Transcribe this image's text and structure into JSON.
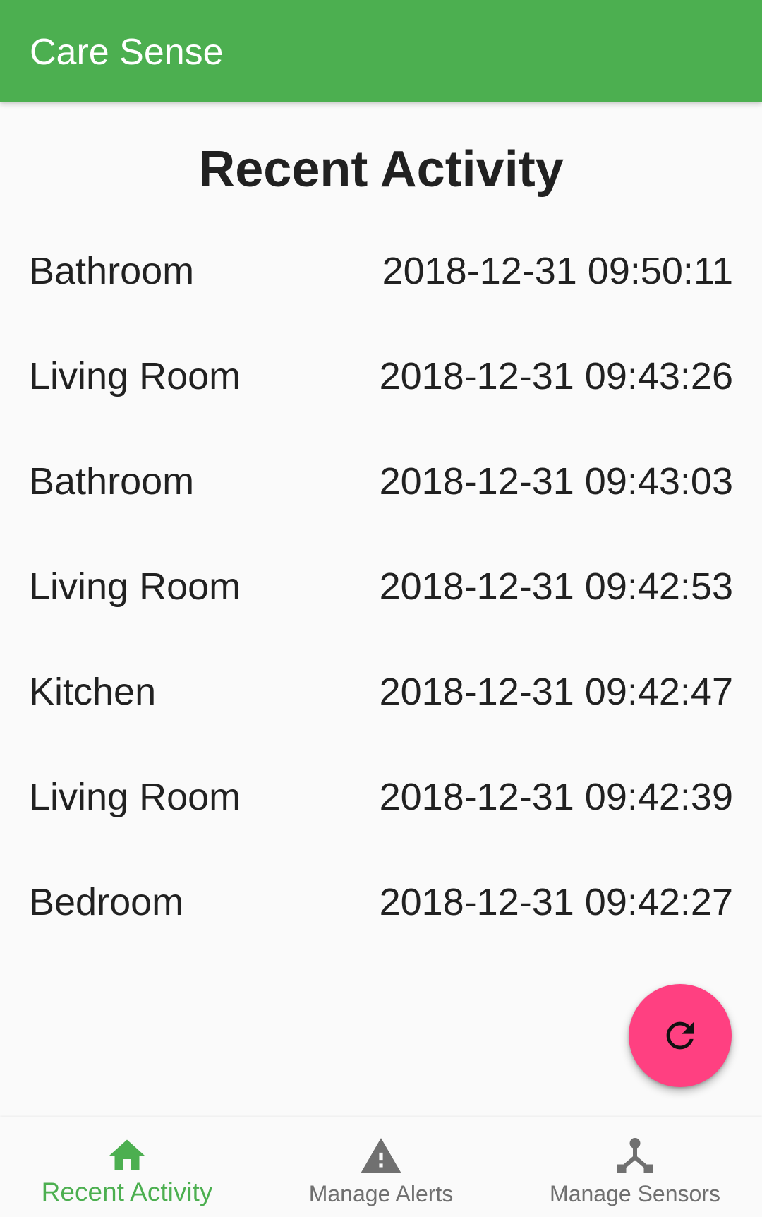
{
  "app_title": "Care Sense",
  "page_title": "Recent Activity",
  "activity": [
    {
      "room": "Bathroom",
      "time": "2018-12-31 09:50:11"
    },
    {
      "room": "Living Room",
      "time": "2018-12-31 09:43:26"
    },
    {
      "room": "Bathroom",
      "time": "2018-12-31 09:43:03"
    },
    {
      "room": "Living Room",
      "time": "2018-12-31 09:42:53"
    },
    {
      "room": "Kitchen",
      "time": "2018-12-31 09:42:47"
    },
    {
      "room": "Living Room",
      "time": "2018-12-31 09:42:39"
    },
    {
      "room": "Bedroom",
      "time": "2018-12-31 09:42:27"
    }
  ],
  "fab": {
    "icon": "refresh-icon",
    "color": "#ff4081"
  },
  "bottom_nav": [
    {
      "label": "Recent Activity",
      "icon": "home-icon",
      "active": true
    },
    {
      "label": "Manage Alerts",
      "icon": "warning-icon",
      "active": false
    },
    {
      "label": "Manage Sensors",
      "icon": "sensors-icon",
      "active": false
    }
  ],
  "colors": {
    "primary": "#4caf50",
    "accent": "#ff4081",
    "inactive": "#707070"
  }
}
